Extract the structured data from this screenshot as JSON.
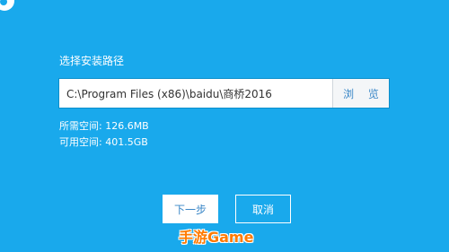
{
  "install": {
    "section_title": "选择安装路径",
    "path_value": "C:\\Program Files (x86)\\baidu\\商桥2016",
    "browse_label": "浏 览",
    "required_space": "所需空间: 126.6MB",
    "available_space": "可用空间: 401.5GB"
  },
  "buttons": {
    "next_label": "下一步",
    "cancel_label": "取消"
  },
  "watermark": {
    "text": "手游Game"
  },
  "colors": {
    "background": "#19a9ec",
    "button_text": "#3a87c7",
    "watermark": "#ff7a00"
  },
  "icons": {
    "corner_logo": "app-logo-icon"
  }
}
